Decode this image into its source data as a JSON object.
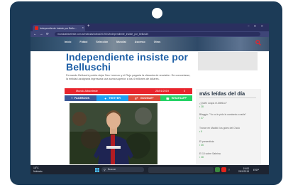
{
  "browser": {
    "tab_title": "Independiente insiste por Bellu...",
    "tab_close": "×",
    "new_tab": "+",
    "url": "mundoalbiceleste.com.ar/noticias/futbol/2019/01/independiente_insiste_por_belluschi",
    "win_controls": [
      "−",
      "□",
      "×"
    ],
    "nav": [
      "←",
      "→",
      "⟳"
    ]
  },
  "site": {
    "nav_items": [
      "Inicio",
      "Fútbol",
      "Selección",
      "Mundial",
      "Ascenso",
      "Otros"
    ],
    "search_icon": "search-icon"
  },
  "article": {
    "title": "Independiente insiste por Belluschi",
    "lead": "Fernando Belluschi podría dejar San Lorenzo y el Rojo pagaría la cláusula de rescisión. De concretarse, la entidad azulgrana ingresaría una suma superior a los 4 millones de dólares.",
    "author": "Mundo Albiceleste",
    "date": "25/01/2019",
    "comments": "0",
    "share": [
      {
        "label": "FACEBOOK",
        "icon": "facebook-icon",
        "color": "#3b5998"
      },
      {
        "label": "TWITTER",
        "icon": "twitter-icon",
        "color": "#1da1f2"
      },
      {
        "label": "GOOGLE+",
        "icon": "google-plus-icon",
        "color": "#dd4b39"
      },
      {
        "label": "WHATSAPP",
        "icon": "whatsapp-icon",
        "color": "#25d366"
      }
    ]
  },
  "sidebar": {
    "title": "más leídas del día",
    "items": [
      {
        "title": "¿Quién ocupa el Atletico?",
        "count": "28"
      },
      {
        "title": "Bilaggio: \"Yo no le pido la camiseta a nadie\"",
        "count": "27"
      },
      {
        "title": "Tronce en Madrid: los goles del Cholo",
        "count": "9"
      },
      {
        "title": "El presentista",
        "count": "35"
      },
      {
        "title": "El 10 sobre Sabrina",
        "count": "28"
      }
    ]
  },
  "taskbar": {
    "temperature": "18°C",
    "weather": "Nublado",
    "search_label": "Buscar",
    "time": "19:00",
    "date": "25/1/2019",
    "lang": "ESP"
  }
}
